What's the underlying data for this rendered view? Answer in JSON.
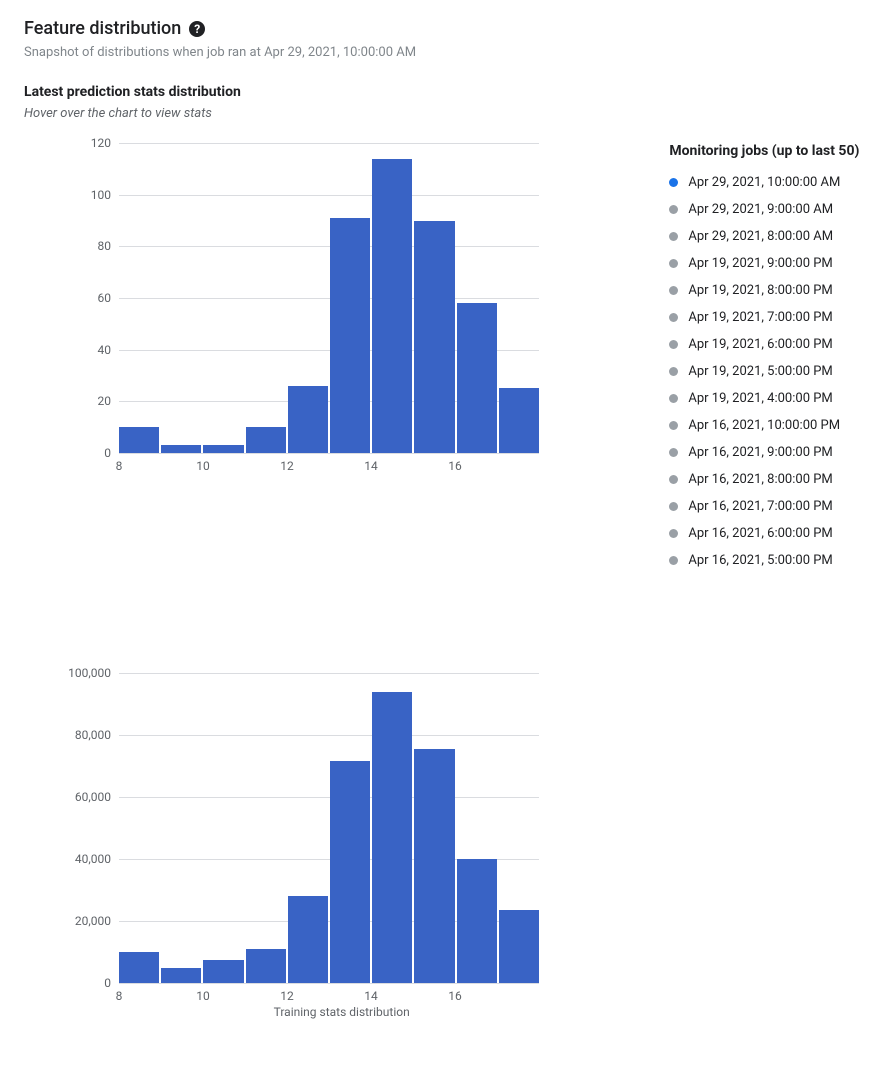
{
  "header": {
    "title": "Feature distribution",
    "help_icon_name": "help-icon",
    "subtitle": "Snapshot of distributions when job ran at Apr 29, 2021, 10:00:00 AM"
  },
  "section": {
    "title": "Latest prediction stats distribution",
    "hint": "Hover over the chart to view stats"
  },
  "jobs": {
    "title": "Monitoring jobs (up to last 50)",
    "items": [
      {
        "label": "Apr 29, 2021, 10:00:00 AM",
        "active": true
      },
      {
        "label": "Apr 29, 2021, 9:00:00 AM",
        "active": false
      },
      {
        "label": "Apr 29, 2021, 8:00:00 AM",
        "active": false
      },
      {
        "label": "Apr 19, 2021, 9:00:00 PM",
        "active": false
      },
      {
        "label": "Apr 19, 2021, 8:00:00 PM",
        "active": false
      },
      {
        "label": "Apr 19, 2021, 7:00:00 PM",
        "active": false
      },
      {
        "label": "Apr 19, 2021, 6:00:00 PM",
        "active": false
      },
      {
        "label": "Apr 19, 2021, 5:00:00 PM",
        "active": false
      },
      {
        "label": "Apr 19, 2021, 4:00:00 PM",
        "active": false
      },
      {
        "label": "Apr 16, 2021, 10:00:00 PM",
        "active": false
      },
      {
        "label": "Apr 16, 2021, 9:00:00 PM",
        "active": false
      },
      {
        "label": "Apr 16, 2021, 8:00:00 PM",
        "active": false
      },
      {
        "label": "Apr 16, 2021, 7:00:00 PM",
        "active": false
      },
      {
        "label": "Apr 16, 2021, 6:00:00 PM",
        "active": false
      },
      {
        "label": "Apr 16, 2021, 5:00:00 PM",
        "active": false
      }
    ]
  },
  "colors": {
    "bar": "#3963c5",
    "job_dot_active": "#1a73e8",
    "job_dot": "#9aa0a6",
    "grid": "#dadce0"
  },
  "chart_data": [
    {
      "type": "bar",
      "title": "Latest prediction stats distribution",
      "xlabel": "",
      "ylabel": "",
      "x_bin_starts": [
        8,
        9,
        10,
        11,
        12,
        13,
        14,
        15,
        16
      ],
      "x_ticks": [
        8,
        10,
        12,
        14,
        16
      ],
      "y_ticks": [
        0,
        20,
        40,
        60,
        80,
        100,
        120
      ],
      "y_tick_labels": [
        "0",
        "20",
        "40",
        "60",
        "80",
        "100",
        "120"
      ],
      "ylim": [
        0,
        120
      ],
      "values": [
        10,
        3,
        3,
        10,
        26,
        91,
        114,
        90,
        58,
        25
      ]
    },
    {
      "type": "bar",
      "title": "Training stats distribution",
      "xlabel": "Training stats distribution",
      "ylabel": "",
      "x_bin_starts": [
        8,
        9,
        10,
        11,
        12,
        13,
        14,
        15,
        16
      ],
      "x_ticks": [
        8,
        10,
        12,
        14,
        16
      ],
      "y_ticks": [
        0,
        20000,
        40000,
        60000,
        80000,
        100000
      ],
      "y_tick_labels": [
        "0",
        "20,000",
        "40,000",
        "60,000",
        "80,000",
        "100,000"
      ],
      "ylim": [
        0,
        100000
      ],
      "values": [
        10000,
        5000,
        7500,
        11000,
        28000,
        71500,
        94000,
        75500,
        40000,
        23500
      ]
    }
  ]
}
